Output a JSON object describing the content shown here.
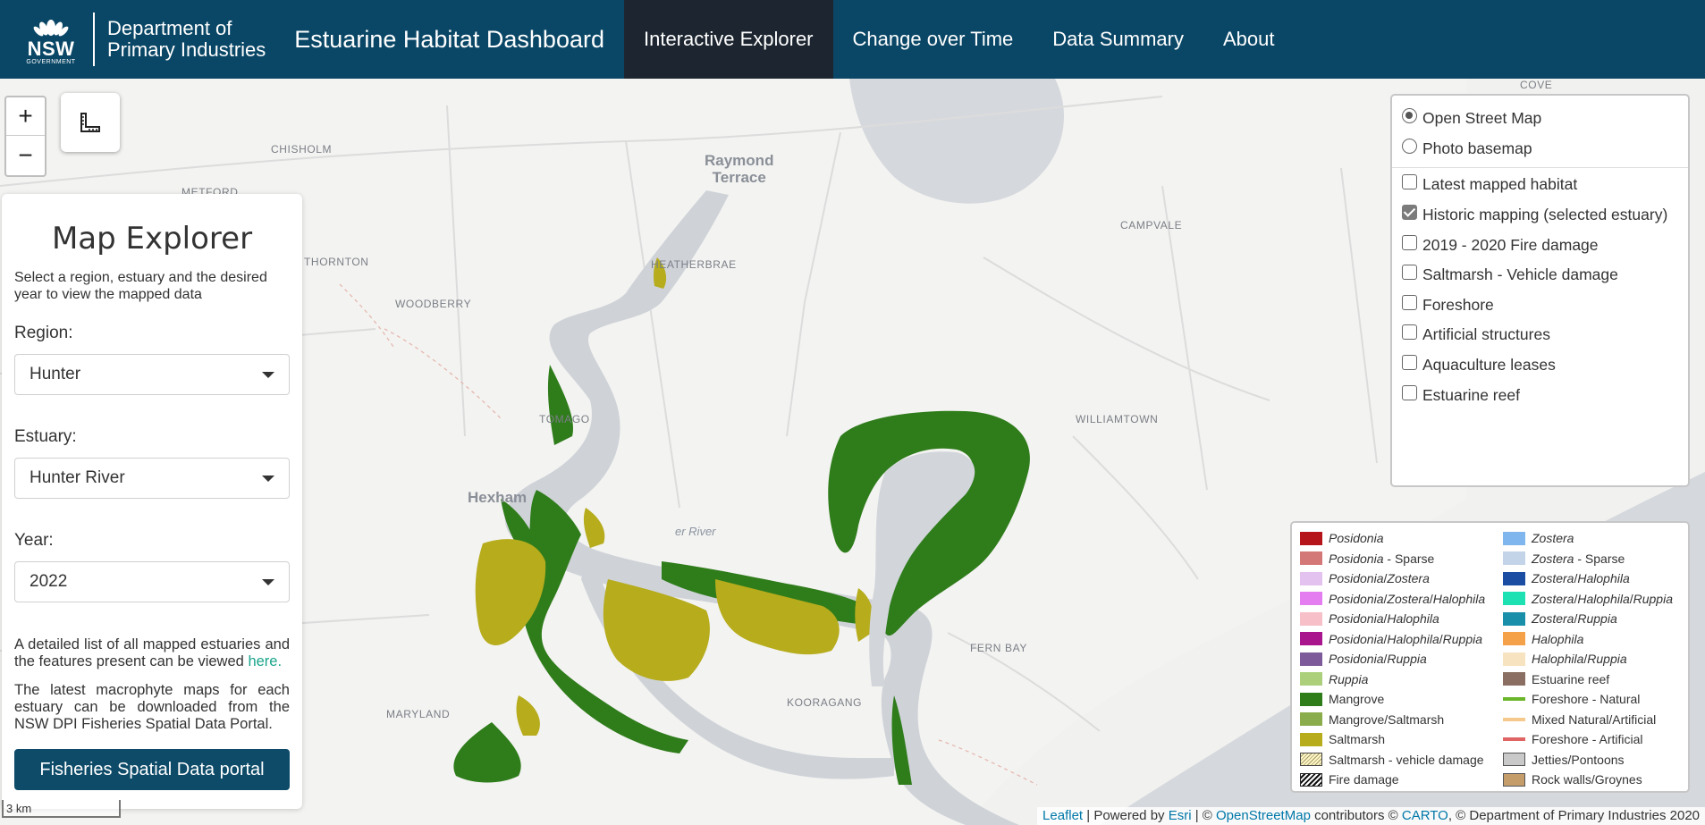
{
  "header": {
    "logo_text": "NSW",
    "logo_sub": "GOVERNMENT",
    "dept_line1": "Department of",
    "dept_line2": "Primary Industries",
    "app_title": "Estuarine Habitat Dashboard",
    "nav": [
      {
        "label": "Interactive Explorer",
        "active": true
      },
      {
        "label": "Change over Time",
        "active": false
      },
      {
        "label": "Data Summary",
        "active": false
      },
      {
        "label": "About",
        "active": false
      }
    ]
  },
  "map": {
    "zoom_in": "+",
    "zoom_out": "−",
    "measure_icon": "ruler-square-icon",
    "labels": {
      "cove": "COVE",
      "chisholm": "CHISHOLM",
      "metford": "METFORD",
      "raymond_terrace_1": "Raymond",
      "raymond_terrace_2": "Terrace",
      "campvale": "CAMPVALE",
      "heatherbrae": "HEATHERBRAE",
      "thornton": "THORNTON",
      "woodberry": "WOODBERRY",
      "tomago": "TOMAGO",
      "williamtown": "WILLIAMTOWN",
      "hexham": "Hexham",
      "river": "er River",
      "fern_bay": "FERN BAY",
      "maryland": "MARYLAND",
      "kooragang": "KOORAGANG"
    },
    "scale_text": "3 km"
  },
  "side_panel": {
    "title": "Map Explorer",
    "intro": "Select a region, estuary and the desired year to view the mapped data",
    "region_label": "Region:",
    "region_value": "Hunter",
    "estuary_label": "Estuary:",
    "estuary_value": "Hunter River",
    "year_label": "Year:",
    "year_value": "2022",
    "list_text": "A detailed list of all mapped estuaries and the features present can be viewed",
    "list_link": "here.",
    "download_text": "The latest macrophyte maps for each estuary can be downloaded from the NSW DPI Fisheries Spatial Data Portal.",
    "portal_button": "Fisheries Spatial Data portal"
  },
  "layers": {
    "basemaps": [
      {
        "label": "Open Street Map",
        "selected": true
      },
      {
        "label": "Photo basemap",
        "selected": false
      }
    ],
    "overlays": [
      {
        "label": "Latest mapped habitat",
        "checked": false
      },
      {
        "label": "Historic mapping (selected estuary)",
        "checked": true
      },
      {
        "label": "2019 - 2020 Fire damage",
        "checked": false
      },
      {
        "label": "Saltmarsh - Vehicle damage",
        "checked": false
      },
      {
        "label": "Foreshore",
        "checked": false
      },
      {
        "label": "Artificial structures",
        "checked": false
      },
      {
        "label": "Aquaculture leases",
        "checked": false
      },
      {
        "label": "Estuarine reef",
        "checked": false
      }
    ]
  },
  "legend": {
    "col1": [
      {
        "parts": [
          [
            "Posidonia",
            true
          ]
        ],
        "color": "#b5141b",
        "kind": "fill"
      },
      {
        "parts": [
          [
            "Posidonia",
            true
          ],
          [
            " - Sparse",
            false
          ]
        ],
        "color": "#d37777",
        "kind": "fill"
      },
      {
        "parts": [
          [
            "Posidonia",
            true
          ],
          [
            "/",
            false
          ],
          [
            "Zostera",
            true
          ]
        ],
        "color": "#e4c2f0",
        "kind": "fill"
      },
      {
        "parts": [
          [
            "Posidonia",
            true
          ],
          [
            "/",
            false
          ],
          [
            "Zostera",
            true
          ],
          [
            "/",
            false
          ],
          [
            "Halophila",
            true
          ]
        ],
        "color": "#e47df0",
        "kind": "fill"
      },
      {
        "parts": [
          [
            "Posidonia",
            true
          ],
          [
            "/",
            false
          ],
          [
            "Halophila",
            true
          ]
        ],
        "color": "#f7bfc8",
        "kind": "fill"
      },
      {
        "parts": [
          [
            "Posidonia",
            true
          ],
          [
            "/",
            false
          ],
          [
            "Halophila",
            true
          ],
          [
            "/",
            false
          ],
          [
            "Ruppia",
            true
          ]
        ],
        "color": "#a8158c",
        "kind": "fill"
      },
      {
        "parts": [
          [
            "Posidonia",
            true
          ],
          [
            "/",
            false
          ],
          [
            "Ruppia",
            true
          ]
        ],
        "color": "#7d5a99",
        "kind": "fill"
      },
      {
        "parts": [
          [
            "Ruppia",
            true
          ]
        ],
        "color": "#abcf7b",
        "kind": "fill"
      },
      {
        "parts": [
          [
            "Mangrove",
            false
          ]
        ],
        "color": "#2f7c1b",
        "kind": "fill"
      },
      {
        "parts": [
          [
            "Mangrove/Saltmarsh",
            false
          ]
        ],
        "color": "#8aac4a",
        "kind": "fill"
      },
      {
        "parts": [
          [
            "Saltmarsh",
            false
          ]
        ],
        "color": "#b6ac1c",
        "kind": "fill"
      },
      {
        "parts": [
          [
            "Saltmarsh - vehicle damage",
            false
          ]
        ],
        "color": "#a19a60",
        "kind": "hatch-light"
      },
      {
        "parts": [
          [
            "Fire damage",
            false
          ]
        ],
        "color": "#111111",
        "kind": "hatch-dark"
      }
    ],
    "col2": [
      {
        "parts": [
          [
            "Zostera",
            true
          ]
        ],
        "color": "#7fb6ee",
        "kind": "fill"
      },
      {
        "parts": [
          [
            "Zostera",
            true
          ],
          [
            " - Sparse",
            false
          ]
        ],
        "color": "#c3d4e8",
        "kind": "fill"
      },
      {
        "parts": [
          [
            "Zostera",
            true
          ],
          [
            "/",
            false
          ],
          [
            "Halophila",
            true
          ]
        ],
        "color": "#1b4da3",
        "kind": "fill"
      },
      {
        "parts": [
          [
            "Zostera",
            true
          ],
          [
            "/",
            false
          ],
          [
            "Halophila",
            true
          ],
          [
            "/",
            false
          ],
          [
            "Ruppia",
            true
          ]
        ],
        "color": "#1de0b3",
        "kind": "fill"
      },
      {
        "parts": [
          [
            "Zostera",
            true
          ],
          [
            "/",
            false
          ],
          [
            "Ruppia",
            true
          ]
        ],
        "color": "#1a8faa",
        "kind": "fill"
      },
      {
        "parts": [
          [
            "Halophila",
            true
          ]
        ],
        "color": "#f4a14a",
        "kind": "fill"
      },
      {
        "parts": [
          [
            "Halophila",
            true
          ],
          [
            "/",
            false
          ],
          [
            "Ruppia",
            true
          ]
        ],
        "color": "#f8e3c0",
        "kind": "fill"
      },
      {
        "parts": [
          [
            "Estuarine reef",
            false
          ]
        ],
        "color": "#8b6e62",
        "kind": "fill"
      },
      {
        "parts": [
          [
            "Foreshore - Natural",
            false
          ]
        ],
        "color": "#6bb52a",
        "kind": "line"
      },
      {
        "parts": [
          [
            "Mixed Natural/Artificial",
            false
          ]
        ],
        "color": "#f5c98c",
        "kind": "line"
      },
      {
        "parts": [
          [
            "Foreshore - Artificial",
            false
          ]
        ],
        "color": "#e06464",
        "kind": "line"
      },
      {
        "parts": [
          [
            "Jetties/Pontoons",
            false
          ]
        ],
        "color": "#c9c9c9",
        "kind": "boxed"
      },
      {
        "parts": [
          [
            "Rock walls/Groynes",
            false
          ]
        ],
        "color": "#c49d6a",
        "kind": "boxed"
      }
    ]
  },
  "attribution": {
    "leaflet": "Leaflet",
    "sep1": " | Powered by ",
    "esri": "Esri",
    "sep2": " | © ",
    "osm": "OpenStreetMap",
    "sep3": " contributors © ",
    "carto": "CARTO",
    "sep4": ", © Department of Primary Industries 2020"
  },
  "colors": {
    "header_bg": "#0a4766",
    "nav_active_bg": "#1d2630",
    "button_bg": "#0d4b69",
    "link": "#1aa58a",
    "water": "#d4d7dc",
    "mangrove": "#2f7c1b",
    "saltmarsh": "#b6ac1c"
  }
}
